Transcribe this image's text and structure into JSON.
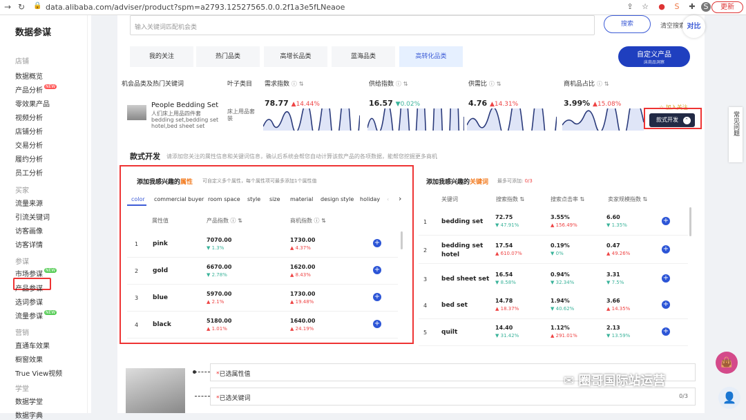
{
  "browser": {
    "url": "data.alibaba.com/adviser/product?spm=a2793.12527565.0.0.2f1a3e5fLNeaoe",
    "update_label": "更新"
  },
  "sidebar": {
    "title": "数据参谋",
    "groups": [
      {
        "label": "店铺",
        "items": [
          {
            "label": "数据概览"
          },
          {
            "label": "产品分析",
            "badge": "NEW"
          },
          {
            "label": "零效果产品"
          },
          {
            "label": "视频分析"
          },
          {
            "label": "店铺分析"
          },
          {
            "label": "交易分析"
          },
          {
            "label": "履约分析"
          },
          {
            "label": "员工分析"
          }
        ]
      },
      {
        "label": "买家",
        "items": [
          {
            "label": "流量来源"
          },
          {
            "label": "引流关键词"
          },
          {
            "label": "访客画像"
          },
          {
            "label": "访客详情"
          }
        ]
      },
      {
        "label": "参谋",
        "items": [
          {
            "label": "市场参谋",
            "badge": "NEW"
          },
          {
            "label": "产品参谋",
            "active": true
          },
          {
            "label": "选词参谋"
          },
          {
            "label": "流量参谋",
            "badge": "NEW"
          }
        ]
      },
      {
        "label": "营销",
        "items": [
          {
            "label": "直通车效果"
          },
          {
            "label": "橱窗效果"
          },
          {
            "label": "True View视频"
          }
        ]
      },
      {
        "label": "学堂",
        "items": [
          {
            "label": "数据学堂"
          },
          {
            "label": "数据字典"
          }
        ]
      }
    ]
  },
  "search": {
    "placeholder": "输入关键词匹配机会类",
    "button": "搜索",
    "clear": "清空搜索框",
    "compare": "对比"
  },
  "tabs": [
    "我的关注",
    "热门品类",
    "高增长品类",
    "蓝海品类",
    "高转化品类"
  ],
  "active_tab": 4,
  "custom_btn": {
    "line1": "自定义产品",
    "line2": "床商品洞察"
  },
  "table_head": {
    "col1": "机会品类及热门关键词",
    "col2": "叶子类目",
    "col3": "需求指数",
    "col4": "供给指数",
    "col5": "供需比",
    "col6": "商机品占比"
  },
  "product": {
    "name": "People Bedding Set",
    "sub1": "人们床上用品四件套",
    "sub2": "bedding set,bedding set",
    "sub3": "hotel,bed sheet set",
    "leaf": "床上用品套装",
    "metrics": [
      {
        "value": "78.77",
        "change": "14.44%",
        "dir": "up"
      },
      {
        "value": "16.57",
        "change": "0.02%",
        "dir": "down"
      },
      {
        "value": "4.76",
        "change": "14.31%",
        "dir": "up"
      },
      {
        "value": "3.99%",
        "change": "15.08%",
        "dir": "up"
      }
    ],
    "follow": "加入关注",
    "style_dev": "款式开发"
  },
  "section": {
    "title": "款式开发",
    "desc": "请添加您关注的属性信息和关键词信息，确认后系统会帮您自动计算该款产品的各项数据，能帮您挖掘更多商机"
  },
  "attr_panel": {
    "title_pre": "添加我感兴趣的",
    "title_hl": "属性",
    "hint": "可自定义多个属性，每个属性项可最多添加1个属性值",
    "tabs": [
      "color",
      "commercial buyer",
      "room space",
      "style",
      "size",
      "material",
      "design style",
      "holiday"
    ],
    "headers": [
      "属性值",
      "产品指数",
      "商机指数"
    ],
    "rows": [
      {
        "idx": "1",
        "name": "pink",
        "v1": "7070.00",
        "c1": "1.3%",
        "d1": "down",
        "v2": "1730.00",
        "c2": "4.37%",
        "d2": "up"
      },
      {
        "idx": "2",
        "name": "gold",
        "v1": "6670.00",
        "c1": "2.78%",
        "d1": "down",
        "v2": "1620.00",
        "c2": "8.43%",
        "d2": "up"
      },
      {
        "idx": "3",
        "name": "blue",
        "v1": "5970.00",
        "c1": "2.1%",
        "d1": "up",
        "v2": "1730.00",
        "c2": "19.48%",
        "d2": "up"
      },
      {
        "idx": "4",
        "name": "black",
        "v1": "5180.00",
        "c1": "1.01%",
        "d1": "up",
        "v2": "1640.00",
        "c2": "24.19%",
        "d2": "up"
      }
    ]
  },
  "kw_panel": {
    "title_pre": "添加我感兴趣的",
    "title_hl": "关键词",
    "hint": "最多可添加:",
    "count": "0/3",
    "headers": [
      "关键词",
      "搜索指数",
      "搜索点击率",
      "卖家规模指数"
    ],
    "rows": [
      {
        "idx": "1",
        "name": "bedding set",
        "name2": "",
        "v1": "72.75",
        "c1": "47.91%",
        "d1": "down",
        "v2": "3.55%",
        "c2": "156.49%",
        "d2": "up",
        "v3": "6.60",
        "c3": "1.35%",
        "d3": "down"
      },
      {
        "idx": "2",
        "name": "bedding set",
        "name2": "hotel",
        "v1": "17.54",
        "c1": "610.07%",
        "d1": "up",
        "v2": "0.19%",
        "c2": "0%",
        "d2": "down",
        "v3": "0.47",
        "c3": "49.26%",
        "d3": "up"
      },
      {
        "idx": "3",
        "name": "bed sheet set",
        "name2": "",
        "v1": "16.54",
        "c1": "8.58%",
        "d1": "down",
        "v2": "0.94%",
        "c2": "32.34%",
        "d2": "down",
        "v3": "3.31",
        "c3": "7.5%",
        "d3": "down"
      },
      {
        "idx": "4",
        "name": "bed set",
        "name2": "",
        "v1": "14.78",
        "c1": "18.37%",
        "d1": "up",
        "v2": "1.94%",
        "c2": "40.62%",
        "d2": "down",
        "v3": "3.66",
        "c3": "14.35%",
        "d3": "up"
      },
      {
        "idx": "5",
        "name": "quilt",
        "name2": "",
        "v1": "14.40",
        "c1": "31.42%",
        "d1": "down",
        "v2": "1.12%",
        "c2": "291.01%",
        "d2": "up",
        "v3": "2.13",
        "c3": "13.59%",
        "d3": "down"
      }
    ]
  },
  "bottom": {
    "attr_field": "已选属性值",
    "kw_field": "已选关键词",
    "kw_count": "0/3"
  },
  "watermark": "圈哥国际站运营",
  "help": "常见问题"
}
